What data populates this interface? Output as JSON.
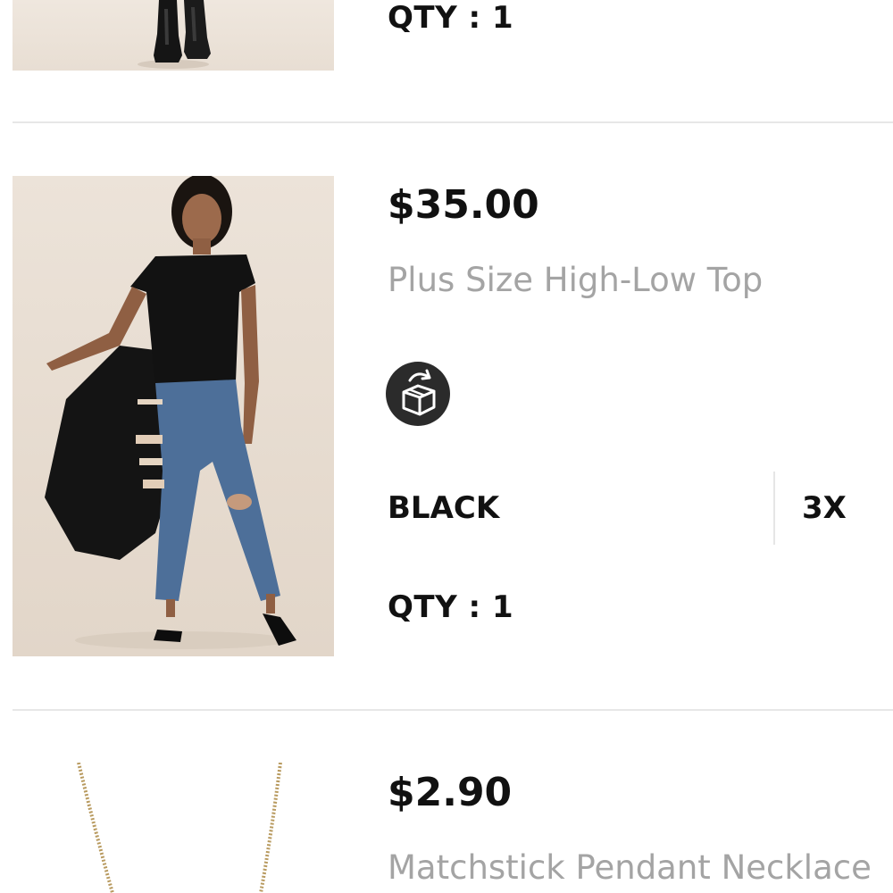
{
  "items": [
    {
      "qty_label": "QTY : 1",
      "image_icon": "boots-product-photo"
    },
    {
      "price": "$35.00",
      "name": "Plus Size High-Low Top",
      "return_icon": "return-box-icon",
      "color": "BLACK",
      "size": "3X",
      "qty_label": "QTY : 1",
      "image_icon": "high-low-top-product-photo"
    },
    {
      "price": "$2.90",
      "name": "Matchstick Pendant Necklace",
      "image_icon": "pendant-necklace-product-photo"
    }
  ],
  "colors": {
    "divider": "#e7e7e7",
    "name_text": "#a4a4a4",
    "primary_text": "#111111",
    "badge_bg": "#2b2b2b",
    "chain_gold": "#b89a5f"
  }
}
